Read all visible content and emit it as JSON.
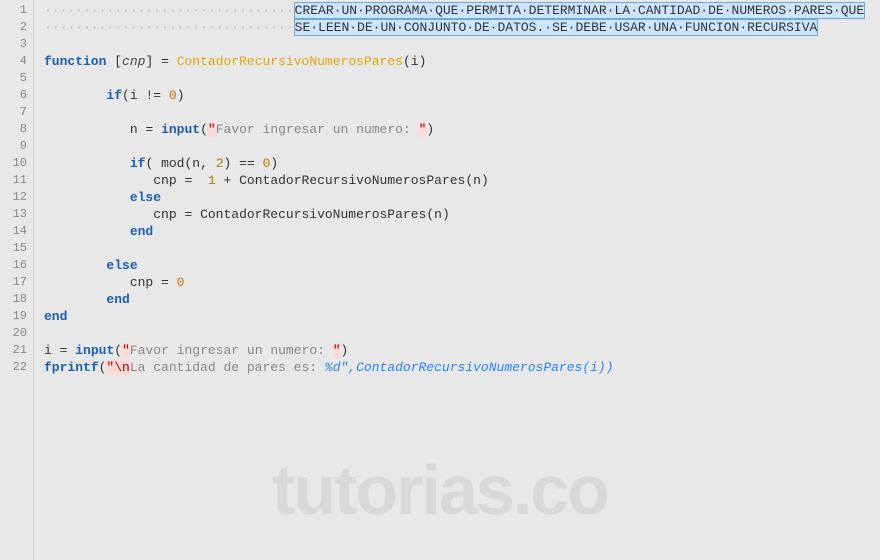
{
  "gutter": {
    "start": 1,
    "end": 22
  },
  "comment": {
    "line1": "CREAR·UN·PROGRAMA·QUE·PERMITA·DETERMINAR·LA·CANTIDAD·DE·NUMEROS·PARES·QUE",
    "line2": "SE·LEEN·DE·UN·CONJUNTO·DE·DATOS.·SE·DEBE·USAR·UNA·FUNCION·RECURSIVA"
  },
  "tokens": {
    "function": "function",
    "if": "if",
    "else": "else",
    "end": "end",
    "input": "input",
    "fprintf": "fprintf",
    "mod": "mod",
    "cnp": "cnp",
    "fn_name": "ContadorRecursivoNumerosPares",
    "i": "i",
    "n": "n",
    "zero": "0",
    "one": "1",
    "two": "2",
    "quote": "\"",
    "esc_n": "\\n",
    "prompt": "Favor ingresar un numero: ",
    "fmt_text": "La cantidad de pares es: ",
    "fmt_spec": "%d\",ContadorRecursivoNumerosPares(i))"
  },
  "watermark": "tutorias.co"
}
